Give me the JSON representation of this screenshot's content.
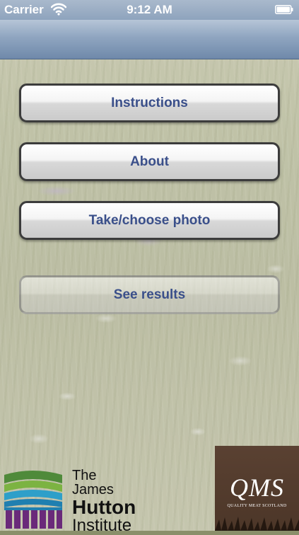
{
  "status_bar": {
    "carrier": "Carrier",
    "time": "9:12 AM",
    "wifi_icon": "wifi-icon",
    "battery_icon": "battery-icon"
  },
  "menu": {
    "instructions_label": "Instructions",
    "about_label": "About",
    "take_photo_label": "Take/choose photo",
    "see_results_label": "See results"
  },
  "logos": {
    "hutton": {
      "line1": "The James",
      "line2": "Hutton",
      "line3": "Institute"
    },
    "qms": {
      "letters": "QMS",
      "subtitle": "QUALITY MEAT SCOTLAND"
    }
  },
  "colors": {
    "button_text": "#3a4f8a",
    "nav_bar": "#8fa5c0",
    "qms_background": "#5a4132"
  }
}
